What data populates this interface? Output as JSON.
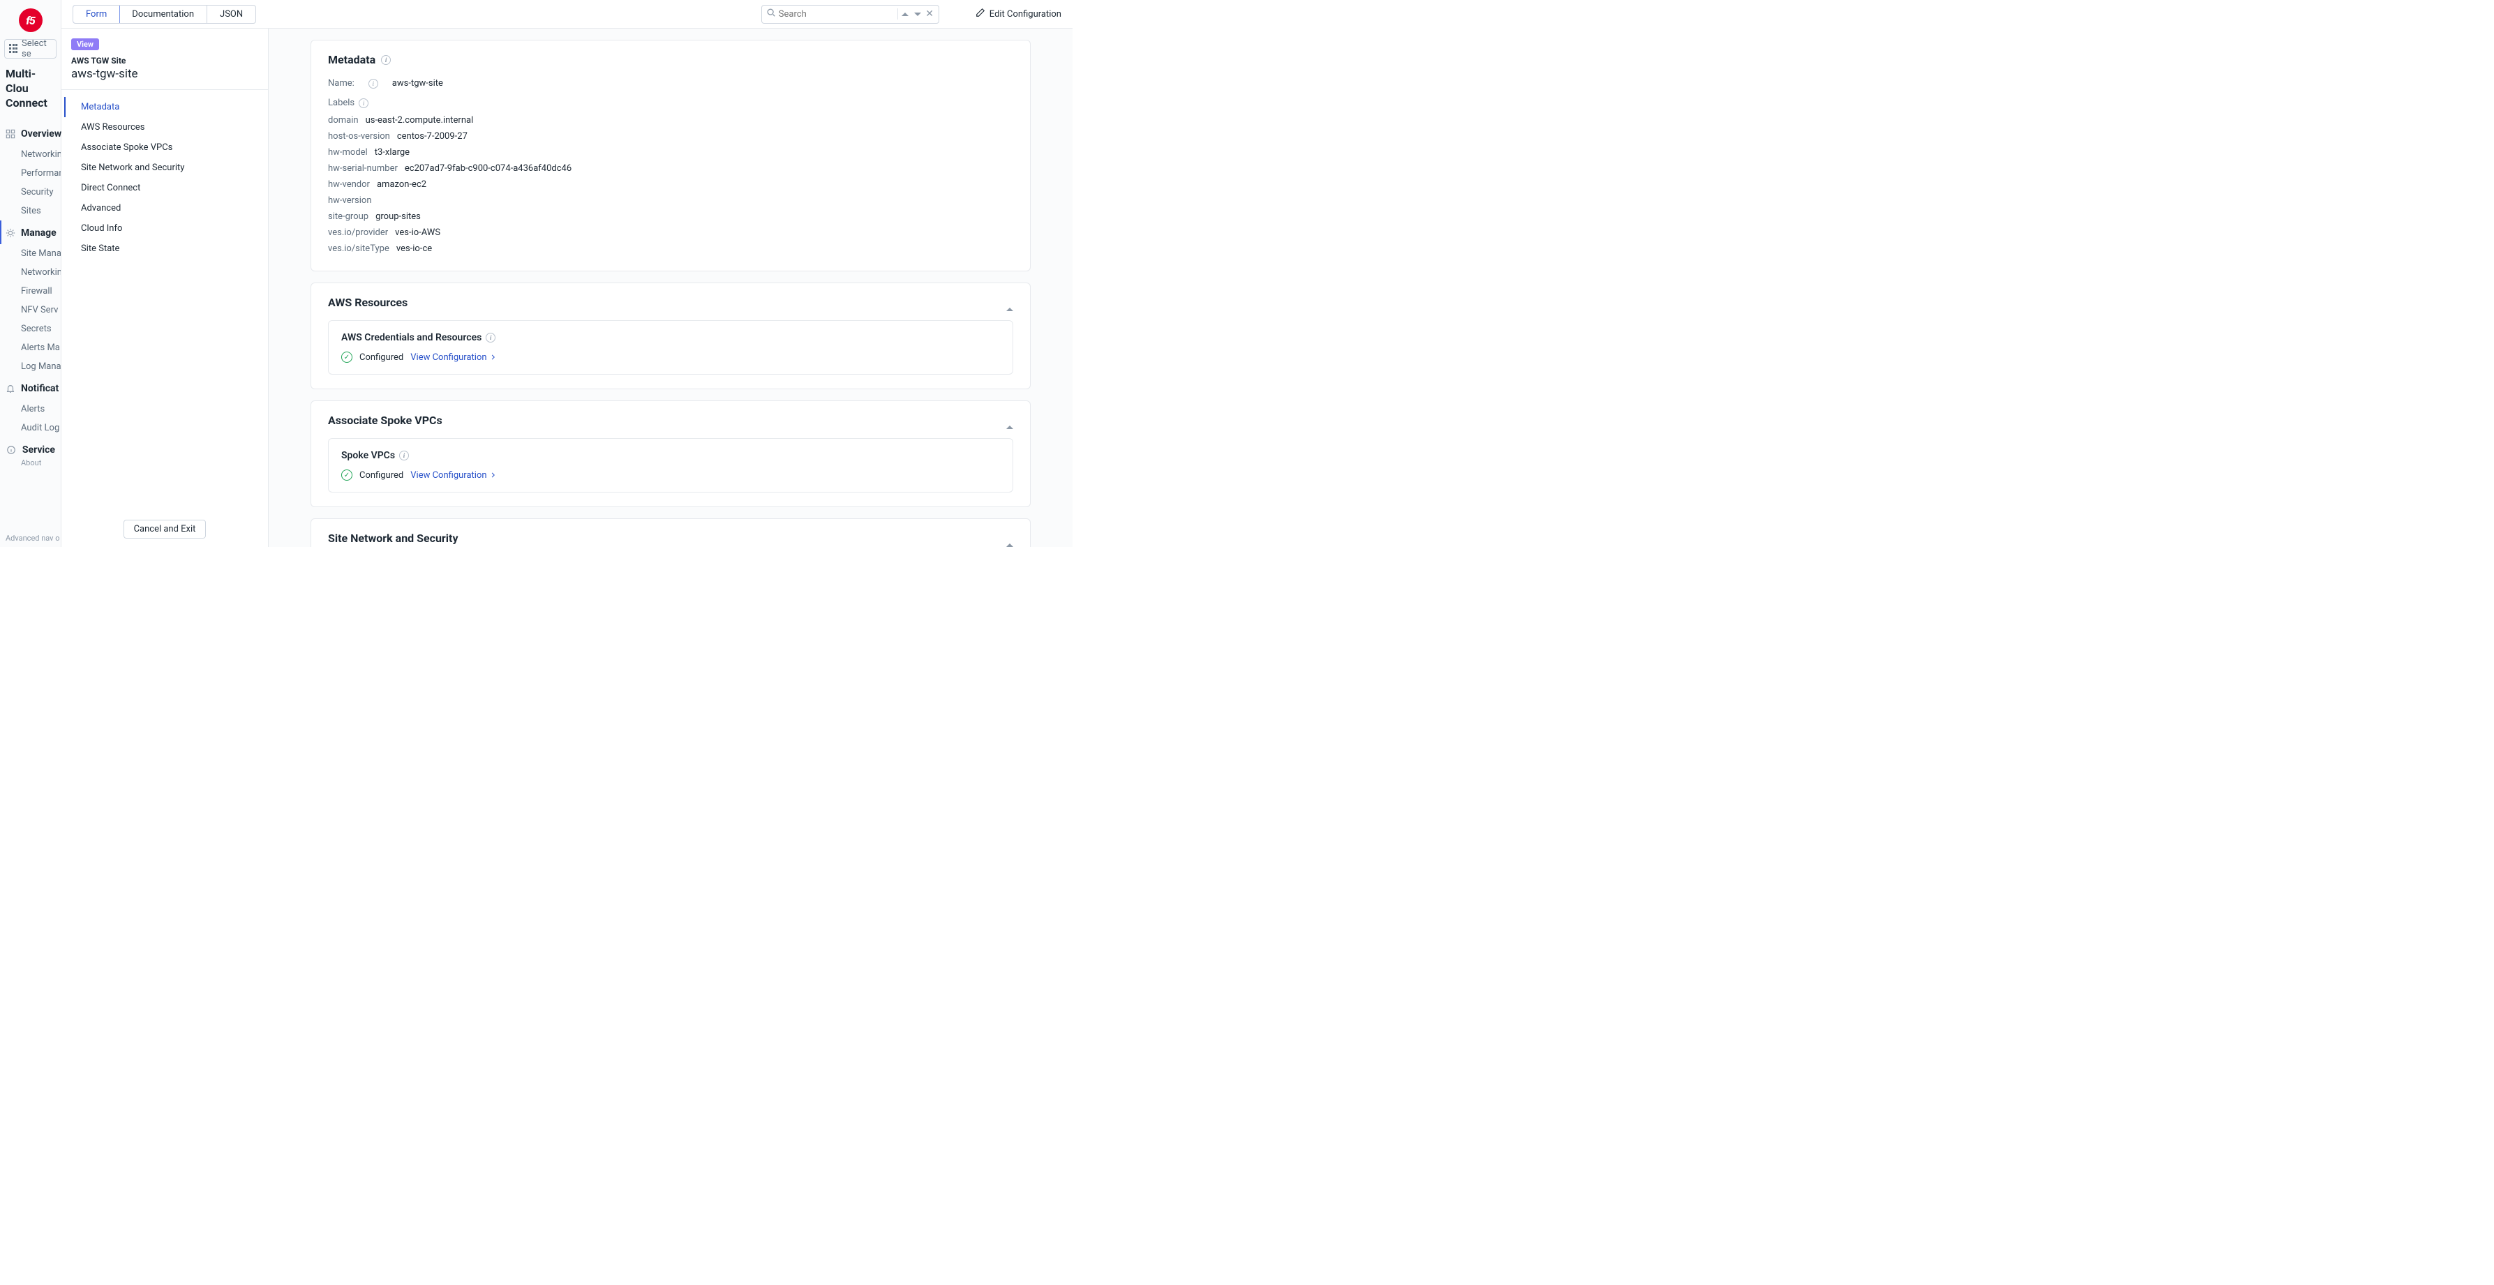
{
  "sidebar": {
    "select_service_label": "Select se",
    "product_title_line1": "Multi-Clou",
    "product_title_line2": "Connect",
    "overview_label": "Overview",
    "overview_items": [
      "Networkin",
      "Performan",
      "Security",
      "Sites"
    ],
    "manage_label": "Manage",
    "manage_items": [
      "Site Mana",
      "Networkin",
      "Firewall",
      "NFV Serv",
      "Secrets",
      "Alerts Ma",
      "Log Mana"
    ],
    "notifications_label": "Notificat",
    "notifications_items": [
      "Alerts",
      "Audit Log"
    ],
    "service_label": "Service",
    "about_label": "About",
    "advanced_nav": "Advanced nav o"
  },
  "topbar": {
    "tabs": {
      "form": "Form",
      "documentation": "Documentation",
      "json": "JSON"
    },
    "search_placeholder": "Search",
    "edit_label": "Edit Configuration"
  },
  "anchor": {
    "badge": "View",
    "type_label": "AWS TGW Site",
    "name": "aws-tgw-site",
    "items": [
      "Metadata",
      "AWS Resources",
      "Associate Spoke VPCs",
      "Site Network and Security",
      "Direct Connect",
      "Advanced",
      "Cloud Info",
      "Site State"
    ],
    "cancel_label": "Cancel and Exit"
  },
  "content": {
    "metadata": {
      "title": "Metadata",
      "name_key": "Name:",
      "name_val": "aws-tgw-site",
      "labels_title": "Labels",
      "labels": [
        {
          "k": "domain",
          "v": "us-east-2.compute.internal"
        },
        {
          "k": "host-os-version",
          "v": "centos-7-2009-27"
        },
        {
          "k": "hw-model",
          "v": "t3-xlarge"
        },
        {
          "k": "hw-serial-number",
          "v": "ec207ad7-9fab-c900-c074-a436af40dc46"
        },
        {
          "k": "hw-vendor",
          "v": "amazon-ec2"
        },
        {
          "k": "hw-version",
          "v": ""
        },
        {
          "k": "site-group",
          "v": "group-sites"
        },
        {
          "k": "ves.io/provider",
          "v": "ves-io-AWS"
        },
        {
          "k": "ves.io/siteType",
          "v": "ves-io-ce"
        }
      ]
    },
    "aws_resources": {
      "title": "AWS Resources",
      "sub_title": "AWS Credentials and Resources",
      "status": "Configured",
      "link": "View Configuration"
    },
    "spoke": {
      "title": "Associate Spoke VPCs",
      "sub_title": "Spoke VPCs",
      "status": "Configured",
      "link": "View Configuration"
    },
    "site_network": {
      "title": "Site Network and Security"
    }
  }
}
